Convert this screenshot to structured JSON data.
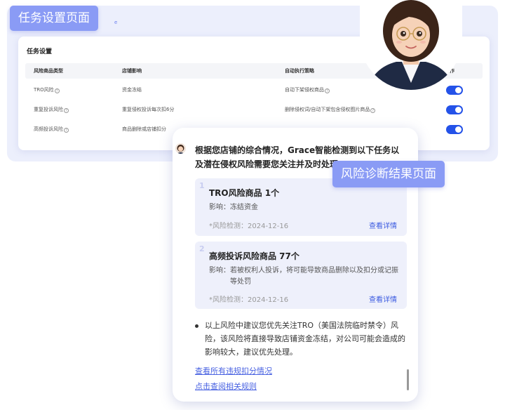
{
  "tags": {
    "settings_page": "任务设置页面",
    "diagnosis_page": "风险诊断结果页面"
  },
  "settings": {
    "title": "任务设置",
    "columns": [
      "风险商品类型",
      "店铺影响",
      "自动执行策略",
      "操作"
    ],
    "rows": [
      {
        "type": "TRO风险",
        "impact": "资金冻结",
        "strategy": "自动下架侵权商品",
        "enabled": true
      },
      {
        "type": "重复投诉风险",
        "impact": "重复侵权投诉每次扣6分",
        "strategy": "删除侵权词/自动下架包含侵权图片商品",
        "enabled": true
      },
      {
        "type": "高频投诉风险",
        "impact": "商品删除或店铺扣分",
        "strategy": "",
        "enabled": true
      }
    ]
  },
  "chat": {
    "intro": "根据您店铺的综合情况，Grace智能检测到以下任务以及潜在侵权风险需要您关注并及时处理：",
    "risks": [
      {
        "index": "1",
        "title": "TRO风险商品 1个",
        "impact_label": "影响：",
        "impact": "冻结资金",
        "date": "*风险检测：2024-12-16",
        "link": "查看详情"
      },
      {
        "index": "2",
        "title": "高频投诉风险商品 77个",
        "impact_label": "影响：",
        "impact": "若被权利人投诉，将可能导致商品删除以及扣分或记振等处罚",
        "date": "*风险检测：2024-12-16",
        "link": "查看详情"
      }
    ],
    "advice": "以上风险中建议您优先关注TRO（美国法院临时禁令）风险，该风险将直接导致店铺资金冻结，对公司可能会造成的影响较大，建议优先处理。",
    "links": [
      "查看所有违规扣分情况",
      "点击查阅相关规则"
    ]
  },
  "colors": {
    "accent": "#2452e8",
    "tag_bg": "#8a9bf5",
    "risk_card_bg": "#eef0fb",
    "link": "#3c5be0"
  }
}
